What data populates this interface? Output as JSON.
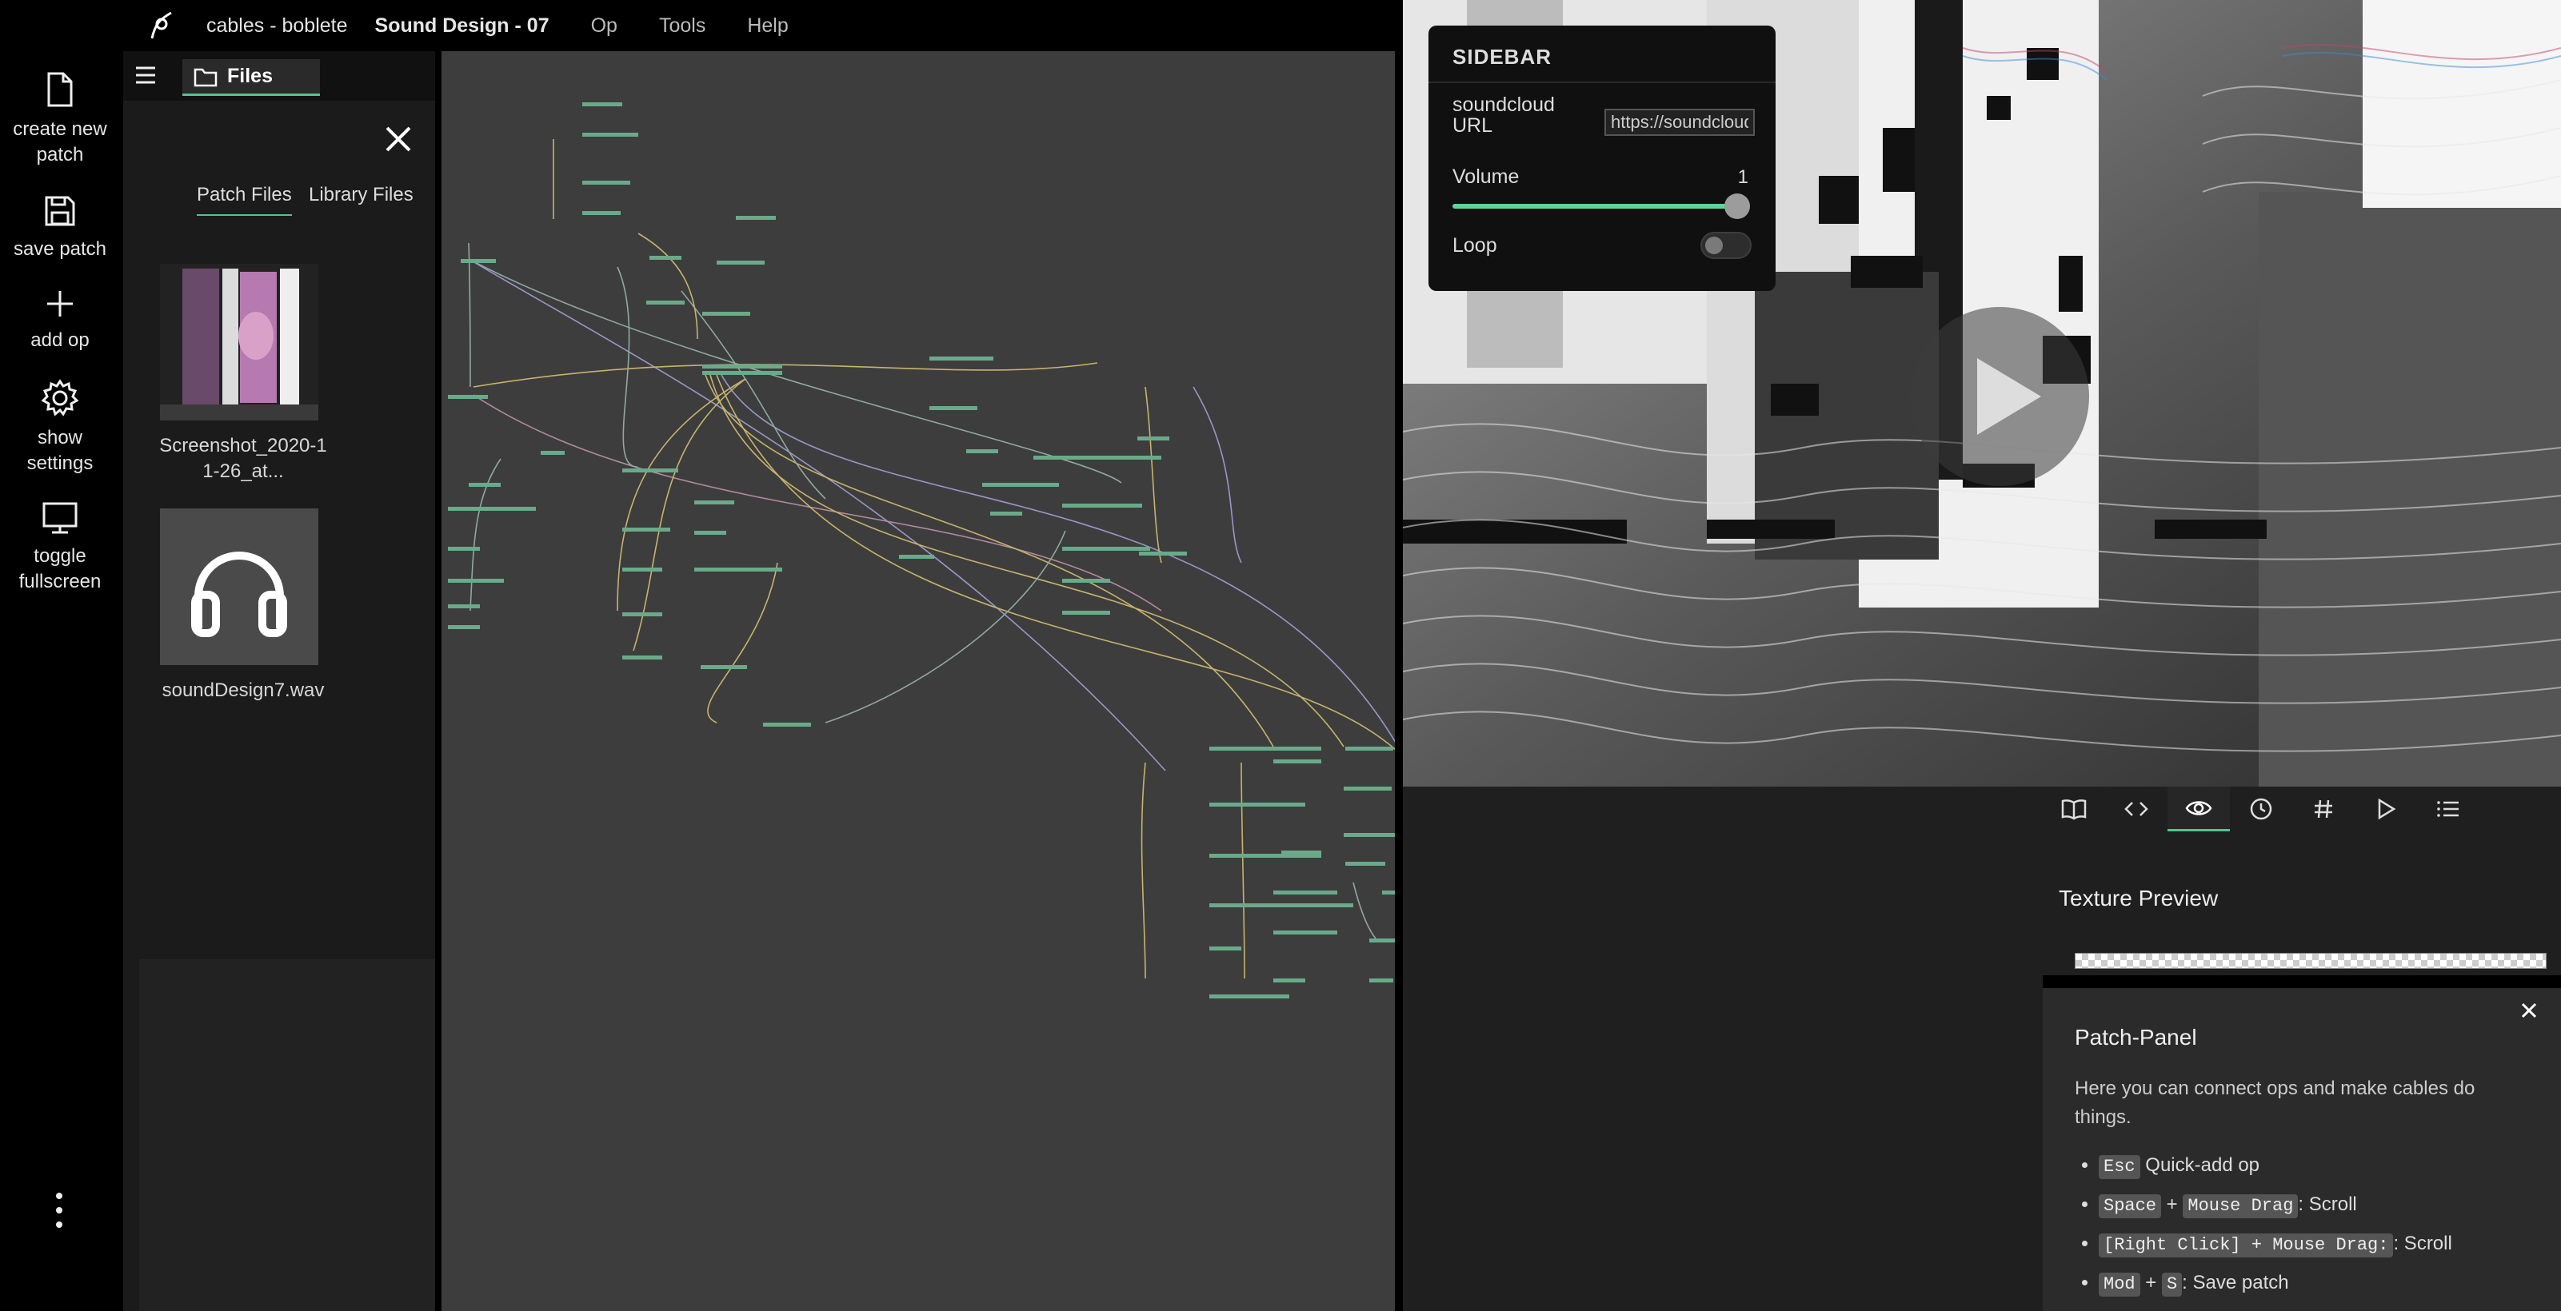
{
  "menubar": {
    "project": "cables - boblete",
    "patch_name": "Sound Design - 07",
    "menus": [
      "Op",
      "Tools",
      "Help"
    ]
  },
  "leftbar": {
    "create": "create new\npatch",
    "save": "save patch",
    "add": "add op",
    "settings": "show\nsettings",
    "fullscreen": "toggle\nfullscreen"
  },
  "files": {
    "tab_label": "Files",
    "subtabs": [
      "Patch Files",
      "Library Files"
    ],
    "items": [
      {
        "name": "Screenshot_2020-1\n1-26_at..."
      },
      {
        "name": "soundDesign7.wav"
      }
    ]
  },
  "sidebar": {
    "heading": "SIDEBAR",
    "url_label": "soundcloud\nURL",
    "url_value": "https://soundcloud",
    "volume_label": "Volume",
    "volume_value": "1",
    "loop_label": "Loop"
  },
  "texture": {
    "title": "Texture Preview"
  },
  "patch_panel": {
    "title": "Patch-Panel",
    "description": "Here you can connect ops and make cables do things.",
    "items": [
      {
        "keys": [
          "Esc"
        ],
        "text": " Quick-add op"
      },
      {
        "keys": [
          "Space",
          "Mouse Drag"
        ],
        "text": ": Scroll"
      },
      {
        "keys": [
          "[Right Click] + Mouse Drag:"
        ],
        "text": ": Scroll"
      },
      {
        "keys": [
          "Mod",
          "S"
        ],
        "text": ": Save patch"
      }
    ]
  },
  "colors": {
    "accent": "#53c48a",
    "canvas_bg": "#3d3d3d",
    "panel_bg": "#1b1b1b"
  }
}
